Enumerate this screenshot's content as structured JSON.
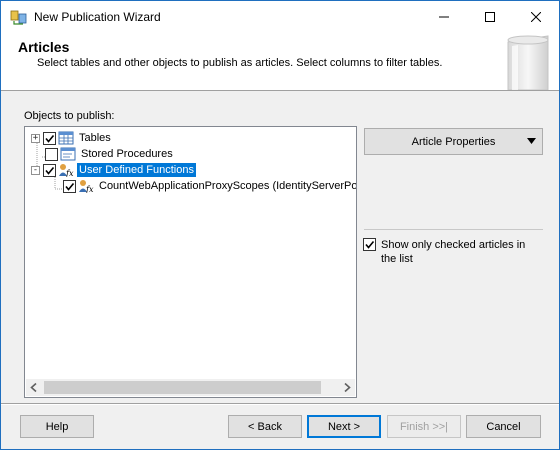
{
  "window": {
    "title": "New Publication Wizard",
    "controls": {
      "minimize": "minimize-icon",
      "maximize": "maximize-icon",
      "close": "close-icon"
    }
  },
  "header": {
    "title": "Articles",
    "description": "Select tables and other objects to publish as articles. Select columns to filter tables."
  },
  "objects": {
    "label": "Objects to publish:",
    "tree": [
      {
        "label": "Tables",
        "expander": "+",
        "checked": true,
        "icon": "table-icon"
      },
      {
        "label": "Stored Procedures",
        "expander": "",
        "checked": false,
        "icon": "stored-procedure-icon"
      },
      {
        "label": "User Defined Functions",
        "expander": "-",
        "checked": true,
        "icon": "function-icon",
        "selected": true
      },
      {
        "label": "CountWebApplicationProxyScopes (IdentityServerPolic",
        "checked": true,
        "icon": "function-icon"
      }
    ]
  },
  "side": {
    "article_properties": "Article Properties",
    "show_checked_label": "Show only checked articles in the list",
    "show_checked": true
  },
  "footer": {
    "help": "Help",
    "back": "< Back",
    "next": "Next >",
    "finish": "Finish >>|",
    "cancel": "Cancel"
  },
  "colors": {
    "accent": "#0078d7",
    "window_border": "#1f6fbf",
    "disabled_text": "#a0a0a0"
  }
}
